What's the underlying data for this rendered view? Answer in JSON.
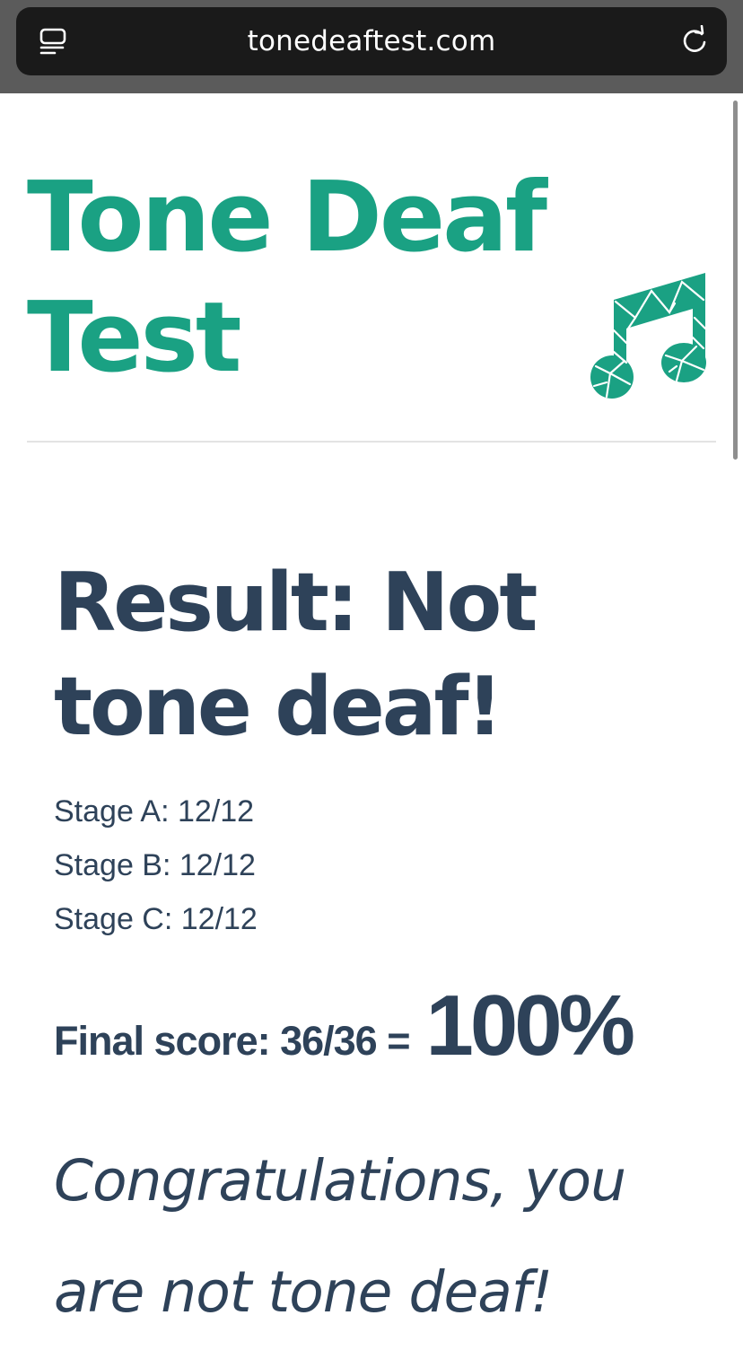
{
  "browser": {
    "url": "tonedeaftest.com",
    "tabs_icon": "tabs-icon",
    "reload_icon": "reload-icon"
  },
  "header": {
    "title": "Tone Deaf Test",
    "logo_icon": "music-note-icon"
  },
  "result": {
    "heading": "Result: Not tone deaf!",
    "stages": [
      {
        "label": "Stage A: 12/12"
      },
      {
        "label": "Stage B: 12/12"
      },
      {
        "label": "Stage C: 12/12"
      }
    ],
    "final_score_label": "Final score: 36/36 =",
    "final_percent": "100%",
    "message": "Congratulations, you are not tone deaf!"
  },
  "colors": {
    "brand": "#1aa183",
    "text": "#2e4259",
    "chrome": "#5b5b5b",
    "address_bar": "#1a1a1a"
  }
}
